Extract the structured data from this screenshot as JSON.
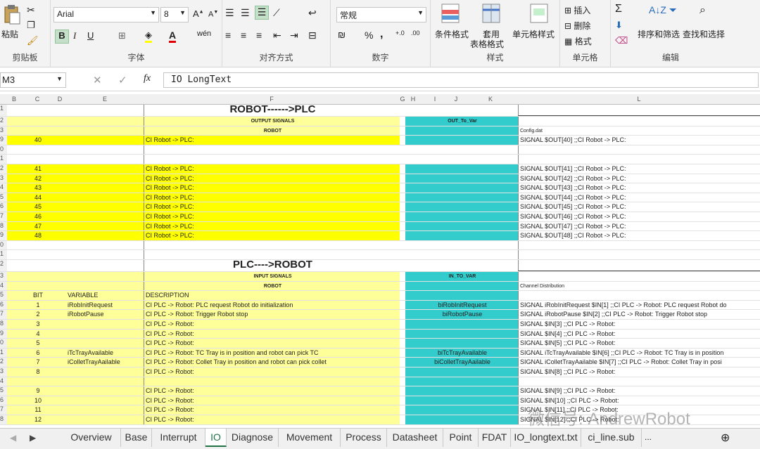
{
  "ribbon": {
    "paste": "粘贴",
    "clipboard": "剪贴板",
    "font_name": "Arial",
    "font_size": "8",
    "font_group": "字体",
    "align_group": "对齐方式",
    "number_format": "常规",
    "number_group": "数字",
    "cond_format": "条件格式",
    "table_format_1": "套用",
    "table_format_2": "表格格式",
    "cell_style": "单元格样式",
    "styles_group": "样式",
    "insert": "插入",
    "delete": "删除",
    "format": "格式",
    "cells_group": "单元格",
    "sort_filter": "排序和筛选",
    "find_select": "查找和选择",
    "edit_group": "编辑",
    "bold": "B",
    "italic": "I",
    "underline": "U",
    "percent": "%",
    "comma": ","
  },
  "formula": {
    "name_box": "M3",
    "fx": "fx",
    "content": "IO LongText"
  },
  "columns": [
    "B",
    "C",
    "D",
    "E",
    "F",
    "G",
    "H",
    "I",
    "J",
    "K",
    "L"
  ],
  "rows": [
    {
      "n": "1",
      "type": "title",
      "f": "ROBOT------>PLC"
    },
    {
      "n": "2",
      "type": "hdr",
      "f": "OUTPUT SIGNALS",
      "k": "OUT_To_Var"
    },
    {
      "n": "3",
      "type": "hdr",
      "f": "ROBOT",
      "l": "Config.dat"
    },
    {
      "n": "9",
      "type": "yel",
      "c": "40",
      "f": "CI Robot -> PLC:",
      "l": "SIGNAL   $OUT[40]  ;;CI Robot -> PLC:"
    },
    {
      "n": "0",
      "type": "blank"
    },
    {
      "n": "1",
      "type": "blank"
    },
    {
      "n": "2",
      "type": "yel",
      "c": "41",
      "f": "CI Robot -> PLC:",
      "l": "SIGNAL   $OUT[41]  ;;CI Robot -> PLC:"
    },
    {
      "n": "3",
      "type": "yel",
      "c": "42",
      "f": "CI Robot -> PLC:",
      "l": "SIGNAL   $OUT[42]  ;;CI Robot -> PLC:"
    },
    {
      "n": "4",
      "type": "yel",
      "c": "43",
      "f": "CI Robot -> PLC:",
      "l": "SIGNAL   $OUT[43]  ;;CI Robot -> PLC:"
    },
    {
      "n": "5",
      "type": "yel",
      "c": "44",
      "f": "CI Robot -> PLC:",
      "l": "SIGNAL   $OUT[44]  ;;CI Robot -> PLC:"
    },
    {
      "n": "6",
      "type": "yel",
      "c": "45",
      "f": "CI Robot -> PLC:",
      "l": "SIGNAL   $OUT[45]  ;;CI Robot -> PLC:"
    },
    {
      "n": "7",
      "type": "yel",
      "c": "46",
      "f": "CI Robot -> PLC:",
      "l": "SIGNAL   $OUT[46]  ;;CI Robot -> PLC:"
    },
    {
      "n": "8",
      "type": "yel",
      "c": "47",
      "f": "CI Robot -> PLC:",
      "l": "SIGNAL   $OUT[47]  ;;CI Robot -> PLC:"
    },
    {
      "n": "9",
      "type": "yel",
      "c": "48",
      "f": "CI Robot -> PLC:",
      "l": "SIGNAL   $OUT[48]  ;;CI Robot -> PLC:"
    },
    {
      "n": "0",
      "type": "blank"
    },
    {
      "n": "1",
      "type": "blank"
    },
    {
      "n": "2",
      "type": "title",
      "f": "PLC---->ROBOT"
    },
    {
      "n": "3",
      "type": "hdr",
      "f": "INPUT SIGNALS",
      "k": "IN_TO_VAR"
    },
    {
      "n": "4",
      "type": "hdr",
      "f": "ROBOT",
      "l": "Channel Distribution"
    },
    {
      "n": "5",
      "type": "lyel",
      "c": "BIT",
      "e": "VARIABLE",
      "f": "DESCRIPTION"
    },
    {
      "n": "6",
      "type": "lyel",
      "c": "1",
      "e": "iRobInitRequest",
      "f": "CI PLC -> Robot: PLC request Robot do initialization",
      "k": "biRobInitRequest",
      "l": "SIGNAL iRobInitRequest  $IN[1]  ;;CI PLC -> Robot: PLC request Robot do"
    },
    {
      "n": "7",
      "type": "lyel",
      "c": "2",
      "e": "iRobotPause",
      "f": "CI PLC -> Robot: Trigger Robot stop",
      "k": "biRobotPause",
      "l": "SIGNAL iRobotPause  $IN[2]  ;;CI PLC -> Robot: Trigger Robot stop"
    },
    {
      "n": "8",
      "type": "lyel",
      "c": "3",
      "f": "CI PLC -> Robot:",
      "l": "SIGNAL   $IN[3]  ;;CI PLC -> Robot:"
    },
    {
      "n": "9",
      "type": "lyel",
      "c": "4",
      "f": "CI PLC -> Robot:",
      "l": "SIGNAL   $IN[4]  ;;CI PLC -> Robot:"
    },
    {
      "n": "0",
      "type": "lyel",
      "c": "5",
      "f": "CI PLC -> Robot:",
      "l": "SIGNAL   $IN[5]  ;;CI PLC -> Robot:"
    },
    {
      "n": "1",
      "type": "lyel",
      "c": "6",
      "e": "iTcTrayAvailable",
      "f": "CI PLC -> Robot: TC Tray is in position and robot can pick TC",
      "k": "biTcTrayAvailable",
      "l": "SIGNAL iTcTrayAvailable  $IN[6]  ;;CI PLC -> Robot: TC Tray is in position"
    },
    {
      "n": "2",
      "type": "lyel",
      "c": "7",
      "e": "iColletTrayAailable",
      "f": "CI PLC -> Robot: Collet Tray in position and robot can pick collet",
      "k": "biColletTrayAailable",
      "l": "SIGNAL iColletTrayAailable  $IN[7]  ;;CI PLC -> Robot: Collet Tray in posi"
    },
    {
      "n": "3",
      "type": "lyel",
      "c": "8",
      "f": "CI PLC -> Robot:",
      "l": "SIGNAL   $IN[8]  ;;CI PLC -> Robot:"
    },
    {
      "n": "4",
      "type": "lyel"
    },
    {
      "n": "5",
      "type": "lyel",
      "c": "9",
      "f": "CI PLC -> Robot:",
      "l": "SIGNAL   $IN[9]  ;;CI PLC -> Robot:"
    },
    {
      "n": "6",
      "type": "lyel",
      "c": "10",
      "f": "CI PLC -> Robot:",
      "l": "SIGNAL   $IN[10]  ;;CI PLC -> Robot:"
    },
    {
      "n": "7",
      "type": "lyel",
      "c": "11",
      "f": "CI PLC -> Robot:",
      "l": "SIGNAL   $IN[11]  ;;CI PLC -> Robot:"
    },
    {
      "n": "8",
      "type": "lyel",
      "c": "12",
      "f": "CI PLC -> Robot:",
      "l": "SIGNAL   $IN[12]  ;;CI PLC -> Robot:"
    }
  ],
  "tabs": [
    "Overview",
    "Base",
    "Interrupt",
    "IO",
    "Diagnose",
    "Movement",
    "Process",
    "Datasheet",
    "Point",
    "FDAT",
    "IO_longtext.txt",
    "ci_line.sub"
  ],
  "active_tab": "IO",
  "more_tabs": "...",
  "watermark": "微信号: AndrewRobot"
}
